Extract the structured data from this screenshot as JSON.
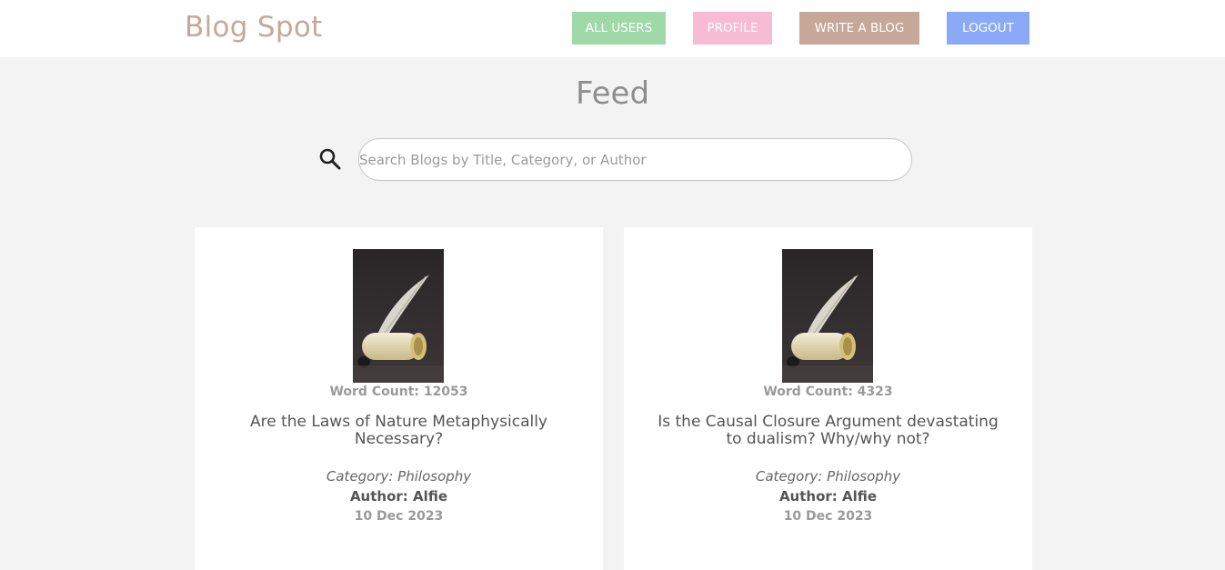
{
  "header": {
    "brand": "Blog Spot",
    "nav": {
      "all_users": "ALL USERS",
      "profile": "PROFILE",
      "write_blog": "WRITE A BLOG",
      "logout": "LOGOUT"
    }
  },
  "main": {
    "title": "Feed",
    "search": {
      "placeholder": "Search Blogs by Title, Category, or Author",
      "value": ""
    }
  },
  "posts": [
    {
      "image_icon": "quill-scroll-image",
      "word_count": "Word Count: 12053",
      "title": "Are the Laws of Nature Metaphysically Necessary?",
      "category": "Category: Philosophy",
      "author": "Author: Alfie",
      "date": "10 Dec 2023"
    },
    {
      "image_icon": "quill-scroll-image",
      "word_count": "Word Count: 4323",
      "title": "Is the Causal Closure Argument devastating to dualism? Why/why not?",
      "category": "Category: Philosophy",
      "author": "Author: Alfie",
      "date": "10 Dec 2023"
    }
  ],
  "colors": {
    "brand": "#c5a898",
    "all_users": "#9fd9a8",
    "profile": "#f7bcd3",
    "write_blog": "#c5a898",
    "logout": "#8aaaf8",
    "background": "#f3f3f3"
  }
}
